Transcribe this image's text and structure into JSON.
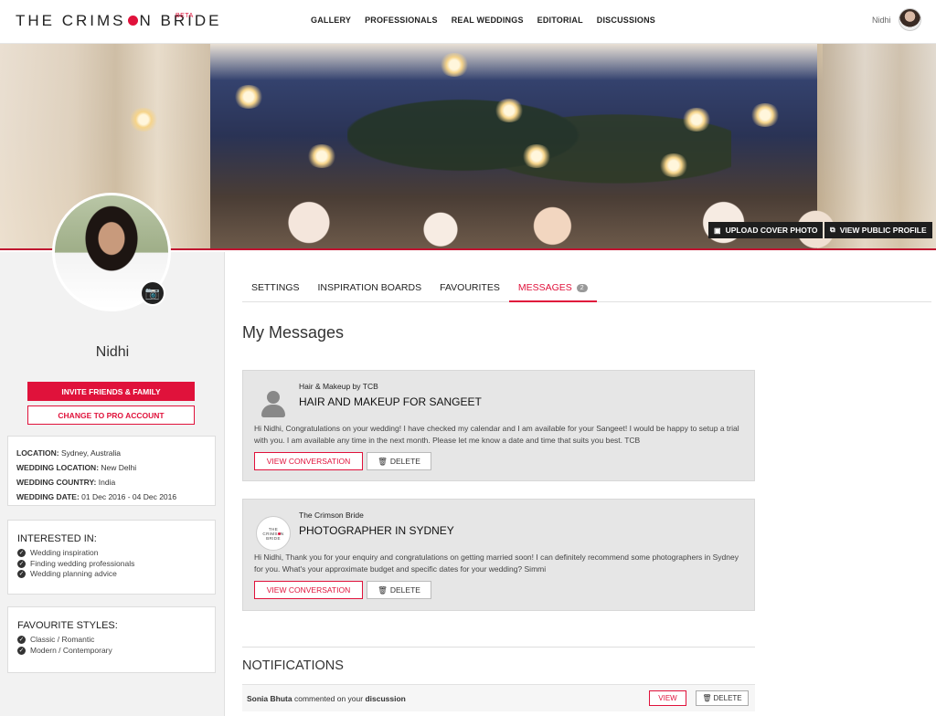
{
  "brand": {
    "logo_left": "THE CRIMS",
    "logo_right": "N BRIDE",
    "beta": "BETA"
  },
  "nav": [
    "GALLERY",
    "PROFESSIONALS",
    "REAL WEDDINGS",
    "EDITORIAL",
    "DISCUSSIONS"
  ],
  "user": {
    "name": "Nidhi"
  },
  "cover": {
    "upload_label": "UPLOAD COVER PHOTO",
    "public_label": "VIEW PUBLIC PROFILE"
  },
  "profile": {
    "name": "Nidhi",
    "invite_label": "INVITE FRIENDS & FAMILY",
    "pro_label": "CHANGE TO PRO ACCOUNT",
    "info": [
      {
        "label": "LOCATION:",
        "value": "Sydney, Australia"
      },
      {
        "label": "WEDDING LOCATION:",
        "value": "New Delhi"
      },
      {
        "label": "WEDDING COUNTRY:",
        "value": "India"
      },
      {
        "label": "WEDDING DATE:",
        "value": "01 Dec 2016 - 04 Dec 2016"
      }
    ],
    "interested_title": "INTERESTED IN:",
    "interested": [
      "Wedding inspiration",
      "Finding wedding professionals",
      "Wedding planning advice"
    ],
    "styles_title": "FAVOURITE STYLES:",
    "styles": [
      "Classic / Romantic",
      "Modern / Contemporary"
    ]
  },
  "tabs": [
    {
      "label": "SETTINGS"
    },
    {
      "label": "INSPIRATION BOARDS"
    },
    {
      "label": "FAVOURITES"
    },
    {
      "label": "MESSAGES",
      "badge": "2"
    }
  ],
  "messages_title": "My Messages",
  "messages": [
    {
      "from": "Hair & Makeup by TCB",
      "subject": "HAIR AND MAKEUP FOR SANGEET",
      "body": "Hi Nidhi, Congratulations on your wedding! I have checked my calendar and I am available for your Sangeet! I would be happy to setup a trial with you. I am available any time in the next month. Please let me know a date and time that suits you best. TCB",
      "view_label": "VIEW CONVERSATION",
      "delete_label": "DELETE"
    },
    {
      "from": "The Crimson Bride",
      "subject": "PHOTOGRAPHER IN SYDNEY",
      "body": "Hi Nidhi, Thank you for your enquiry and congratulations on getting married soon! I can definitely recommend some photographers in Sydney for you. What's your approximate budget and specific dates for your wedding? Simmi",
      "view_label": "VIEW CONVERSATION",
      "delete_label": "DELETE"
    }
  ],
  "notifications_title": "NOTIFICATIONS",
  "notification": {
    "actor": "Sonia Bhuta",
    "action": "commented on your",
    "object": "discussion",
    "view_label": "VIEW",
    "delete_label": "DELETE"
  },
  "avatar_brand": {
    "line1": "THE",
    "line2a": "CRIMS",
    "line2b": "N",
    "line3": "BRIDE"
  },
  "colors": {
    "accent": "#e0123b",
    "dark": "#1e1e1e",
    "card": "#e6e6e6"
  },
  "icons": {
    "camera": "camera-icon",
    "image": "image-icon",
    "external": "external-link-icon",
    "trash": "trash-icon",
    "check": "check-circle-icon"
  }
}
